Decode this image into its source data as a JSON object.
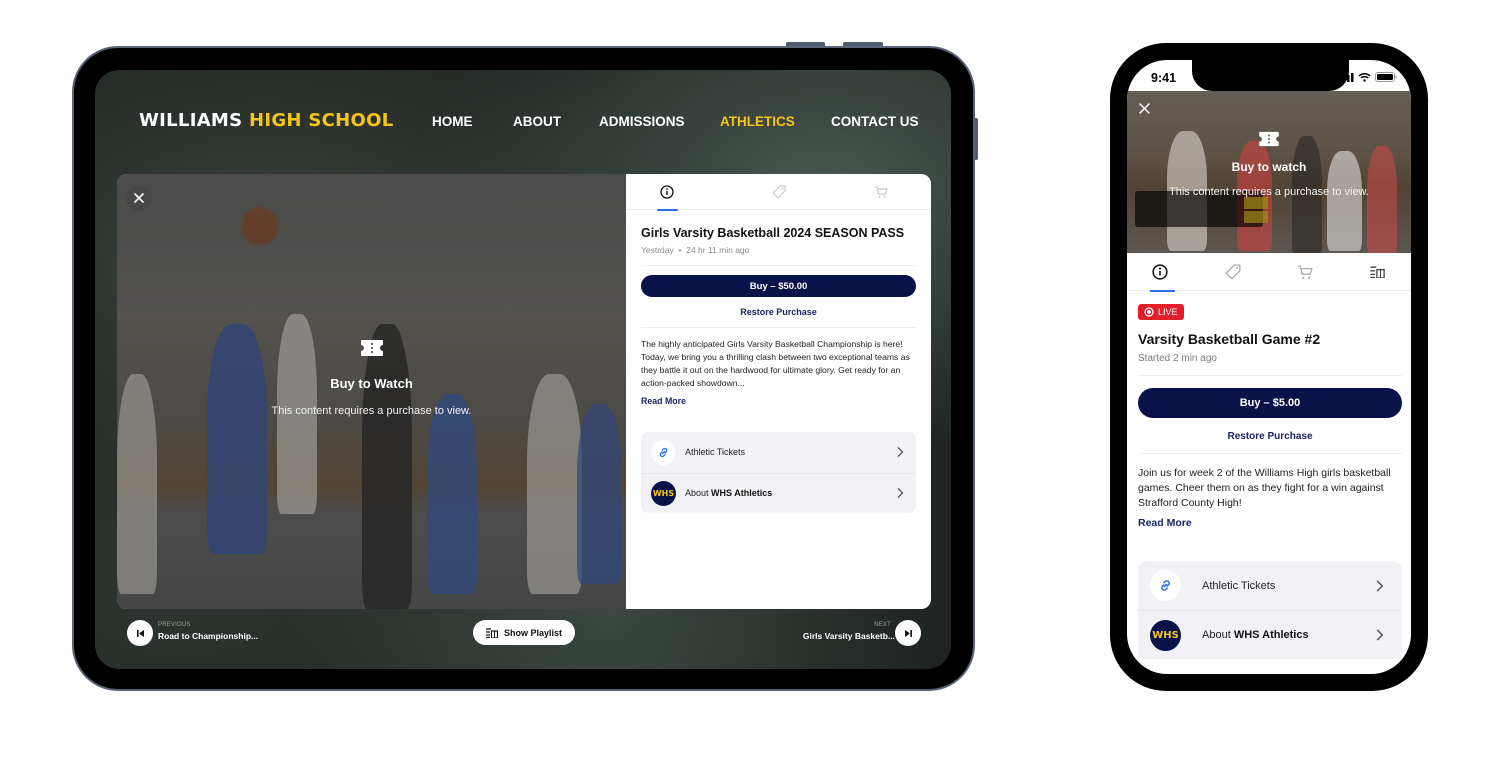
{
  "tablet": {
    "site": {
      "logo_main": "WILLIAMS",
      "logo_accent": "HIGH SCHOOL",
      "accent_color": "#f5c518",
      "nav": [
        {
          "label": "HOME",
          "active": false
        },
        {
          "label": "ABOUT",
          "active": false
        },
        {
          "label": "ADMISSIONS",
          "active": false
        },
        {
          "label": "ATHLETICS",
          "active": true
        },
        {
          "label": "CONTACT US",
          "active": false
        }
      ]
    },
    "player": {
      "close_icon": "close-icon",
      "overlay_icon": "ticket-icon",
      "overlay_title": "Buy to Watch",
      "overlay_subtitle": "This content requires a purchase to view."
    },
    "panel": {
      "tabs": [
        {
          "icon": "info-icon",
          "active": true
        },
        {
          "icon": "tag-icon",
          "active": false
        },
        {
          "icon": "cart-icon",
          "active": false
        }
      ],
      "title": "Girls Varsity Basketball 2024 SEASON PASS",
      "meta_date": "Yestrday",
      "meta_sep": "•",
      "meta_ago": "24 hr 11 min ago",
      "buy_label": "Buy – $50.00",
      "restore_label": "Restore Purchase",
      "description": "The highly anticipated Girls Varsity Basketball Championship is here! Today, we bring you a thrilling clash between two exceptional teams as they battle it out on the hardwood for ultimate glory. Get ready for an action-packed showdown...",
      "read_more": "Read More",
      "links": [
        {
          "icon": "link-icon",
          "label_prefix": "Athletic Tickets",
          "label_bold": ""
        },
        {
          "icon": "whs-logo",
          "badge_text": "WHS",
          "label_prefix": "About ",
          "label_bold": "WHS Athletics"
        }
      ]
    },
    "bottom": {
      "previous_caption": "PREVIOUS",
      "previous_title": "Road to Championship...",
      "playlist_label": "Show Playlist",
      "next_caption": "NEXT",
      "next_title": "Girls Varsity Basketb..."
    }
  },
  "phone": {
    "status_time": "9:41",
    "player": {
      "overlay_title": "Buy to watch",
      "overlay_subtitle": "This content requires a purchase to view."
    },
    "tabs": [
      {
        "icon": "info-icon",
        "active": true
      },
      {
        "icon": "tag-icon",
        "active": false
      },
      {
        "icon": "cart-icon",
        "active": false
      },
      {
        "icon": "playlist-icon",
        "active": false
      }
    ],
    "live_label": "LIVE",
    "live_color": "#e21e2a",
    "title": "Varsity Basketball Game #2",
    "meta": "Started 2 min ago",
    "buy_label": "Buy – $5.00",
    "restore_label": "Restore Purchase",
    "description": "Join us for week 2 of the Williams High girls basketball games. Cheer them on as they fight for a win against Strafford County High!",
    "read_more": "Read More",
    "links": [
      {
        "icon": "link-icon",
        "label_prefix": "Athletic Tickets",
        "label_bold": ""
      },
      {
        "icon": "whs-logo",
        "badge_text": "WHS",
        "label_prefix": "About ",
        "label_bold": "WHS Athletics"
      }
    ]
  },
  "colors": {
    "navy": "#0a124a",
    "link_navy": "#1a2466",
    "tab_indicator": "#2d6cf0",
    "gold": "#f5c518"
  }
}
